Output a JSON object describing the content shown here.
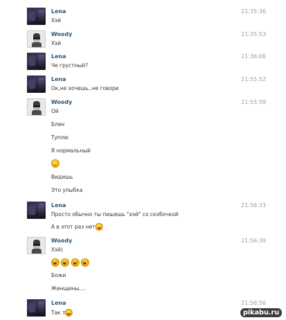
{
  "messages": [
    {
      "sender": "Lena",
      "avatar": "lena",
      "time": "21:35:36",
      "lines": [
        "Хэй"
      ]
    },
    {
      "sender": "Woody",
      "avatar": "woody",
      "time": "21:35:53",
      "lines": [
        "Хэй"
      ]
    },
    {
      "sender": "Lena",
      "avatar": "lena",
      "time": "21:36:06",
      "lines": [
        "Че грустный?"
      ]
    },
    {
      "sender": "Lena",
      "avatar": "lena",
      "time": "21:55:52",
      "lines": [
        "Ок,не хочешь..не говори"
      ]
    },
    {
      "sender": "Woody",
      "avatar": "woody",
      "time": "21:55:58",
      "lines": [
        "Ой",
        "Блен",
        "Туплю",
        "Я нормальный",
        "",
        "Видишь",
        "Это улыбка"
      ]
    },
    {
      "sender": "Lena",
      "avatar": "lena",
      "time": "21:56:33",
      "lines": [
        "Просто обычно ты пишешь \"хэй\" со скобочкой",
        "А в этот раз нет"
      ]
    },
    {
      "sender": "Woody",
      "avatar": "woody",
      "time": "21:56:39",
      "lines": [
        "Хэй)",
        "",
        "Божи",
        "Женщины...."
      ]
    },
    {
      "sender": "Lena",
      "avatar": "lena",
      "time": "21:56:56",
      "lines": [
        "Так т"
      ]
    }
  ],
  "emoji": {
    "smile": "smile-emoji",
    "tongue": "tongue-emoji",
    "laugh": "laughing-crying-emoji"
  },
  "watermark": "pikabu.ru",
  "colors": {
    "name": "#2b587a",
    "time": "#999999",
    "text": "#333333"
  }
}
